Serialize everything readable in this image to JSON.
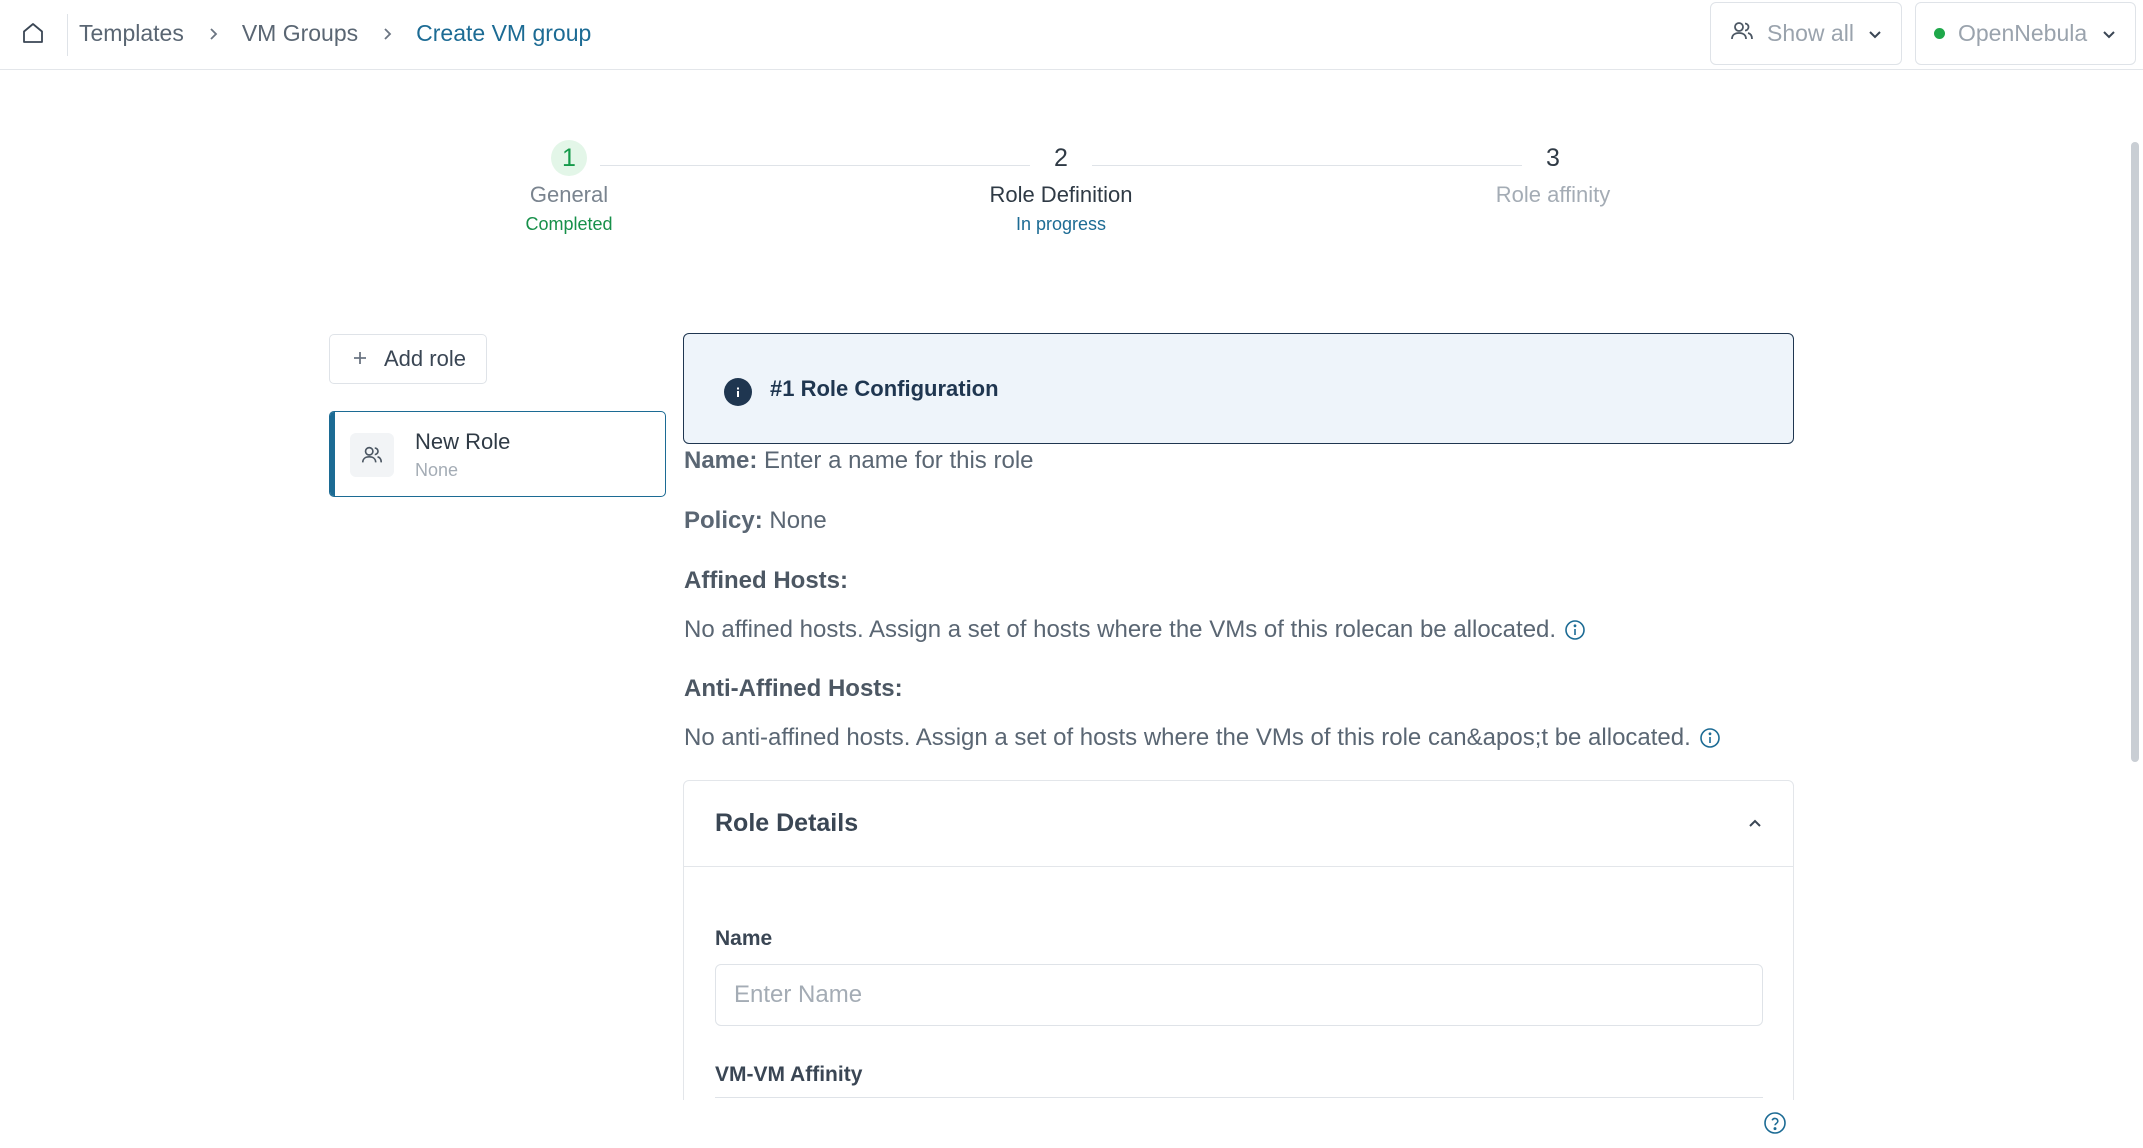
{
  "header": {
    "breadcrumbs": [
      "Templates",
      "VM Groups",
      "Create VM group"
    ],
    "show_all_label": "Show all",
    "zone_label": "OpenNebula",
    "zone_status_color": "#1ea84a"
  },
  "stepper": {
    "steps": [
      {
        "number": "1",
        "title": "General",
        "status": "Completed"
      },
      {
        "number": "2",
        "title": "Role Definition",
        "status": "In progress"
      },
      {
        "number": "3",
        "title": "Role affinity",
        "status": ""
      }
    ]
  },
  "sidebar": {
    "add_role_label": "Add role",
    "roles": [
      {
        "name": "New Role",
        "subtitle": "None"
      }
    ]
  },
  "role_config": {
    "banner_title": "#1 Role Configuration",
    "name_label": "Name:",
    "name_value": "Enter a name for this role",
    "policy_label": "Policy:",
    "policy_value": "None",
    "affined_hosts_title": "Affined Hosts:",
    "affined_hosts_text": "No affined hosts. Assign a set of hosts where the VMs of this rolecan be allocated.",
    "anti_affined_hosts_title": "Anti-Affined Hosts:",
    "anti_affined_hosts_text": "No anti-affined hosts. Assign a set of hosts where the VMs of this role can&apos;t be allocated."
  },
  "role_details": {
    "title": "Role Details",
    "name_label": "Name",
    "name_placeholder": "Enter Name",
    "name_value": "",
    "vm_affinity_label": "VM-VM Affinity"
  },
  "colors": {
    "accent": "#1c6b94",
    "banner_border": "#1f3650",
    "banner_bg": "#eef4fa",
    "completed": "#17904a"
  },
  "icons": {
    "home": "home-icon",
    "breadcrumb_separator": "chevron-right-icon",
    "show_all": "users-icon",
    "dropdown": "chevron-down-icon",
    "add": "plus-icon",
    "role": "users-icon",
    "info": "info-icon",
    "collapse": "chevron-up-icon",
    "help": "help-icon"
  }
}
